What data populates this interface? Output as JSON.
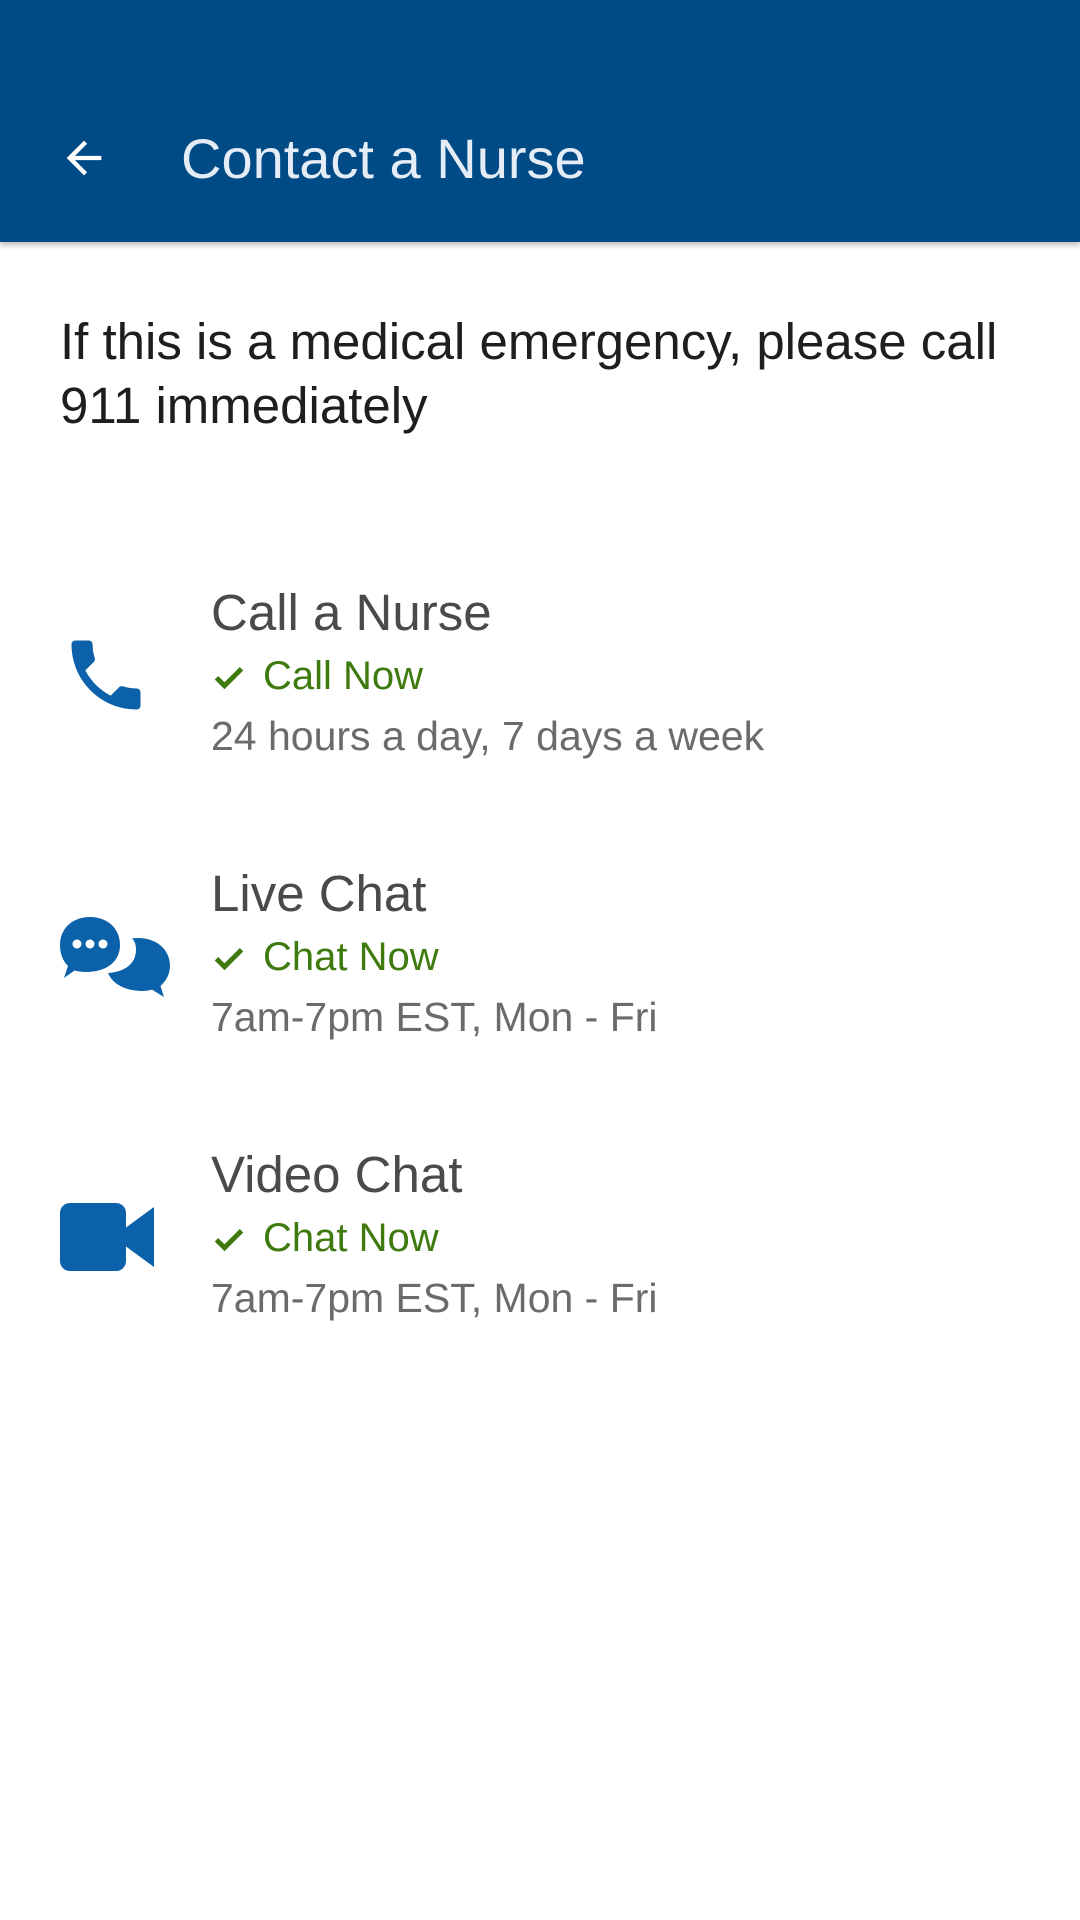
{
  "colors": {
    "app_bar": "#004a85",
    "title_text": "#e4ecf5",
    "icon_blue": "#0b62aa",
    "status_green": "#3f7a0f",
    "body_text": "#1e1e1e",
    "option_title": "#4a4a4a",
    "option_hours": "#6b6b6b"
  },
  "header": {
    "back_icon": "arrow-left-icon",
    "title": "Contact a Nurse"
  },
  "notice": {
    "text": "If this is a medical emergency, please call 911 immediately"
  },
  "options": [
    {
      "icon": "phone-icon",
      "title": "Call a Nurse",
      "status_icon": "check-icon",
      "status": "Call Now",
      "hours": "24 hours a day, 7 days a week"
    },
    {
      "icon": "chat-bubbles-icon",
      "title": "Live Chat",
      "status_icon": "check-icon",
      "status": "Chat Now",
      "hours": "7am-7pm EST, Mon - Fri"
    },
    {
      "icon": "video-camera-icon",
      "title": "Video Chat",
      "status_icon": "check-icon",
      "status": "Chat Now",
      "hours": "7am-7pm EST, Mon - Fri"
    }
  ]
}
